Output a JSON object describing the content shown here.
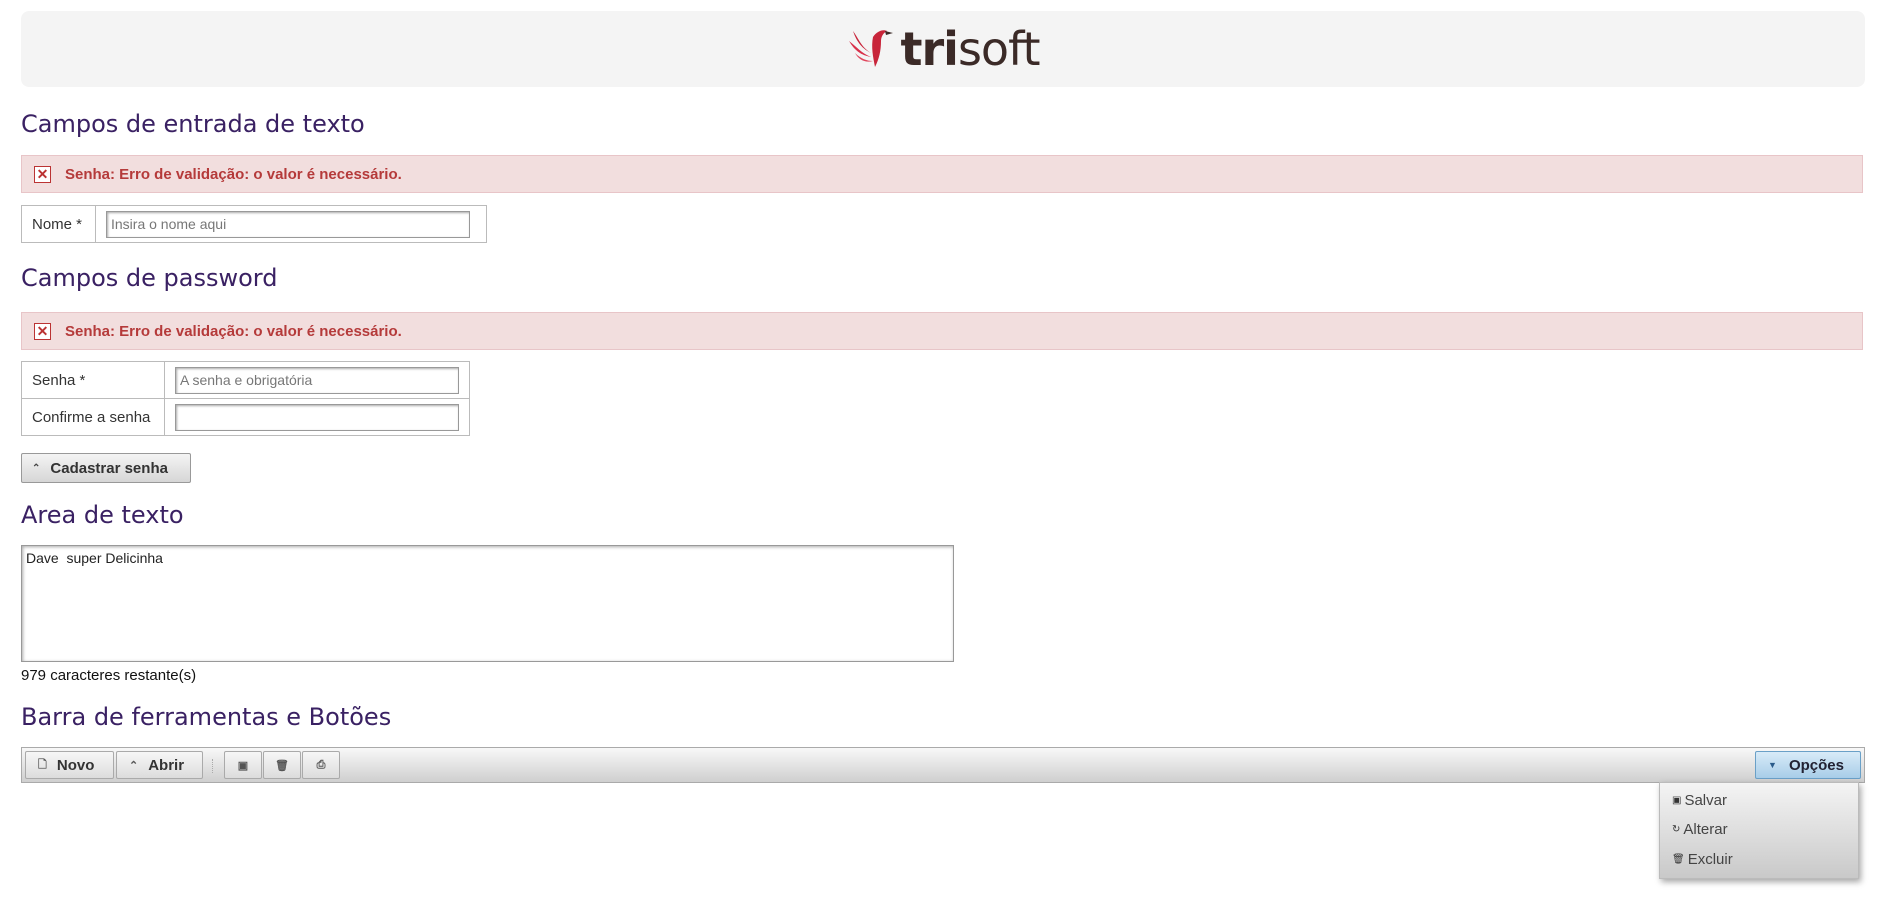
{
  "header": {
    "logo_text_bold": "tri",
    "logo_text_light": "soft"
  },
  "text_inputs": {
    "title": "Campos de entrada de texto",
    "error": "Senha: Erro de validação: o valor é necessário.",
    "name_label": "Nome *",
    "name_placeholder": "Insira o nome aqui",
    "name_value": ""
  },
  "password": {
    "title": "Campos de password",
    "error": "Senha: Erro de validação: o valor é necessário.",
    "senha_label": "Senha *",
    "senha_placeholder": "A senha e obrigatória",
    "confirm_label": "Confirme a senha",
    "button_label": "Cadastrar senha"
  },
  "textarea": {
    "title": "Area de texto",
    "value": "Dave  super Delicinha",
    "counter": "979 caracteres restante(s)"
  },
  "toolbar": {
    "title": "Barra de ferramentas e Botões",
    "novo": "Novo",
    "abrir": "Abrir",
    "opcoes": "Opções",
    "icons": [
      "save-icon",
      "trash-icon",
      "print-icon"
    ]
  },
  "menu": {
    "items": [
      {
        "label": "Salvar",
        "icon": "save-icon"
      },
      {
        "label": "Alterar",
        "icon": "refresh-icon"
      },
      {
        "label": "Excluir",
        "icon": "trash-icon"
      }
    ]
  },
  "colors": {
    "title": "#3a2163",
    "error_bg": "#f2dede",
    "error_text": "#b53a3a",
    "logo_red": "#c8253a"
  }
}
